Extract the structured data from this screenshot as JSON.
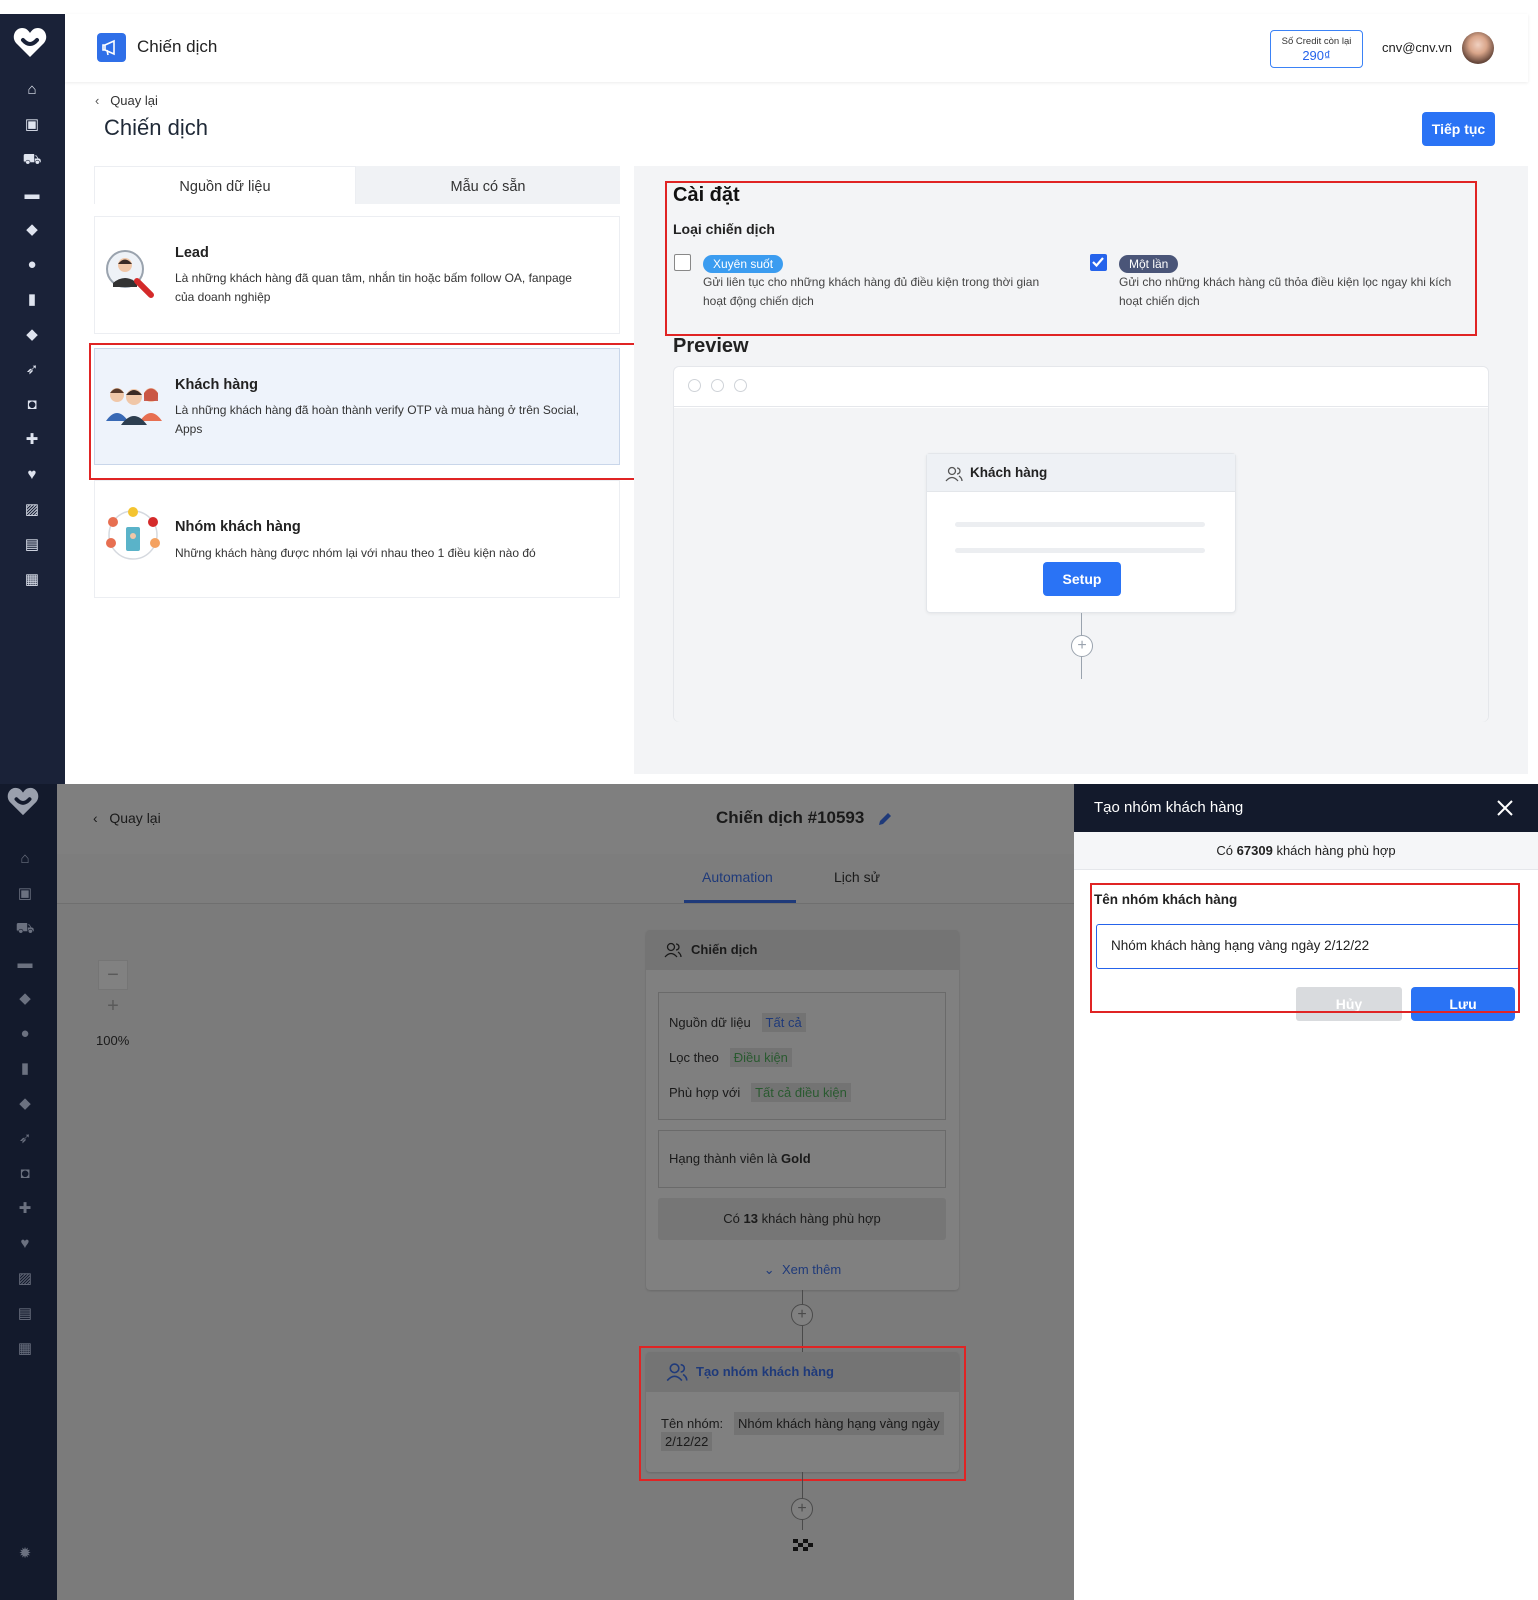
{
  "top": {
    "header": {
      "app_title": "Chiến dịch",
      "credit_label": "Số Credit còn lại",
      "credit_value": "290₫",
      "user_email": "cnv@cnv.vn"
    },
    "page": {
      "back_label": "Quay lại",
      "title": "Chiến dịch",
      "continue_button": "Tiếp tục"
    },
    "tabs": [
      "Nguồn dữ liệu",
      "Mẫu có sẵn"
    ],
    "sources": [
      {
        "title": "Lead",
        "desc_line1": "Là những khách hàng đã quan tâm, nhắn tin hoặc bấm follow OA, fanpage",
        "desc_line2": "của doanh nghiệp"
      },
      {
        "title": "Khách hàng",
        "desc_line1": "Là những khách hàng đã hoàn thành verify OTP và mua hàng ở trên Social,",
        "desc_line2": "Apps"
      },
      {
        "title": "Nhóm khách hàng",
        "desc_line1": "Những khách hàng được nhóm lại với nhau theo 1 điều kiện nào đó",
        "desc_line2": ""
      }
    ],
    "settings": {
      "title": "Cài đặt",
      "type_label": "Loại chiến dịch",
      "options": [
        {
          "badge": "Xuyên suốt",
          "checked": false,
          "desc_line1": "Gửi liên tục cho những khách hàng đủ điều kiện trong thời gian",
          "desc_line2": "hoạt động chiến dịch",
          "color": "#3b9cf0"
        },
        {
          "badge": "Một lần",
          "checked": true,
          "desc_line1": "Gửi cho những khách hàng cũ thỏa điều kiện lọc ngay khi kích",
          "desc_line2": "hoạt chiến dịch",
          "color": "#4a5578"
        }
      ]
    },
    "preview": {
      "title": "Preview",
      "node_title": "Khách hàng",
      "setup_button": "Setup"
    }
  },
  "bottom": {
    "back_label": "Quay lại",
    "campaign_title": "Chiến dịch #10593",
    "tabs": [
      "Automation",
      "Lịch sử"
    ],
    "zoom": "100%",
    "campaign_node": {
      "title": "Chiến dịch",
      "source_label": "Nguồn dữ liệu",
      "source_value": "Tất cả",
      "filter_label": "Lọc theo",
      "filter_value": "Điều kiện",
      "match_label": "Phù hợp với",
      "match_value": "Tất cả điều kiện",
      "condition_prefix": "Hạng thành viên là",
      "condition_value": "Gold",
      "count_prefix": "Có",
      "count_value": "13",
      "count_suffix": "khách hàng phù hợp",
      "more_label": "Xem thêm"
    },
    "group_node": {
      "title": "Tạo nhóm khách hàng",
      "name_label": "Tên nhóm:",
      "name_value_line1": "Nhóm khách hàng hạng vàng ngày",
      "name_value_line2": "2/12/22"
    },
    "drawer": {
      "title": "Tạo nhóm khách hàng",
      "count_prefix": "Có",
      "count_value": "67309",
      "count_suffix": "khách hàng phù hợp",
      "field_label": "Tên nhóm khách hàng",
      "field_value": "Nhóm khách hàng hạng vàng ngày 2/12/22",
      "cancel_button": "Hủy",
      "save_button": "Lưu"
    }
  },
  "colors": {
    "accent": "#2a73f5",
    "sidebar": "#1a2238",
    "highlight": "#e02424"
  }
}
